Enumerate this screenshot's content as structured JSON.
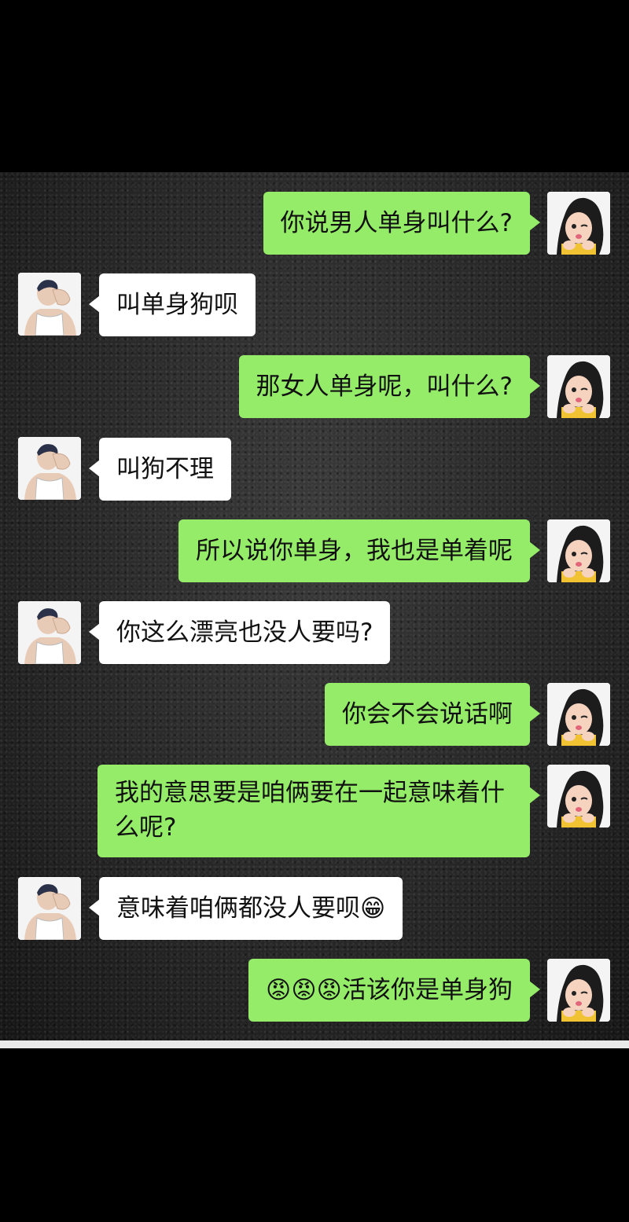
{
  "messages": [
    {
      "side": "me",
      "text": "你说男人单身叫什么?"
    },
    {
      "side": "them",
      "text": "叫单身狗呗"
    },
    {
      "side": "me",
      "text": "那女人单身呢，叫什么?"
    },
    {
      "side": "them",
      "text": "叫狗不理"
    },
    {
      "side": "me",
      "text": "所以说你单身，我也是单着呢"
    },
    {
      "side": "them",
      "text": "你这么漂亮也没人要吗?"
    },
    {
      "side": "me",
      "text": "你会不会说话啊"
    },
    {
      "side": "me",
      "text": "我的意思要是咱俩要在一起意味着什么呢?"
    },
    {
      "side": "them",
      "text": "意味着咱俩都没人要呗😁"
    },
    {
      "side": "me",
      "text": "😡😡😡活该你是单身狗"
    }
  ],
  "colors": {
    "me_bubble": "#95ec69",
    "them_bubble": "#ffffff",
    "background": "#262626"
  }
}
